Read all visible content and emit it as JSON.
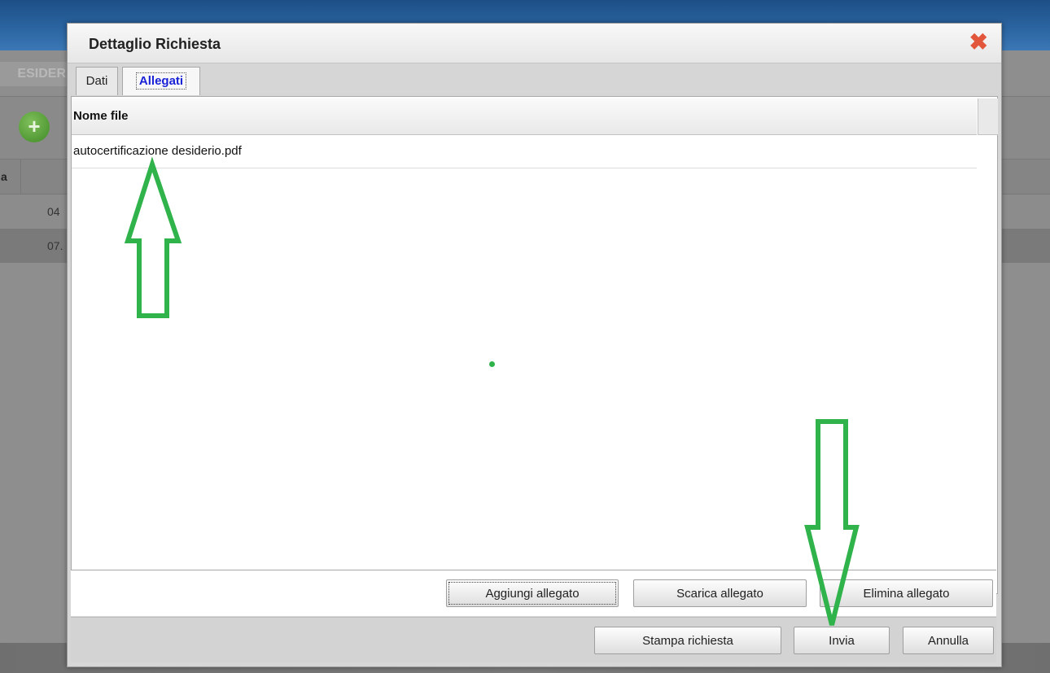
{
  "background": {
    "section_title": "ESIDER",
    "add_icon": "plus-circle-icon",
    "column_header_fragment": "a",
    "rows": [
      "04",
      "07."
    ]
  },
  "dialog": {
    "title": "Dettaglio Richiesta",
    "close_icon": "close-x-icon",
    "close_color": "#e2563b",
    "tabs": [
      {
        "label": "Dati",
        "active": false
      },
      {
        "label": "Allegati",
        "active": true
      }
    ],
    "table": {
      "column_header": "Nome file",
      "rows": [
        "autocertificazione desiderio.pdf"
      ]
    },
    "attachment_buttons": {
      "add": "Aggiungi allegato",
      "download": "Scarica allegato",
      "delete": "Elimina allegato"
    },
    "footer_buttons": {
      "print": "Stampa richiesta",
      "send": "Invia",
      "cancel": "Annulla"
    }
  },
  "annotations": {
    "arrow_color": "#2fb34a",
    "arrows": [
      "up-arrow-to-file",
      "down-arrow-to-invia"
    ]
  }
}
